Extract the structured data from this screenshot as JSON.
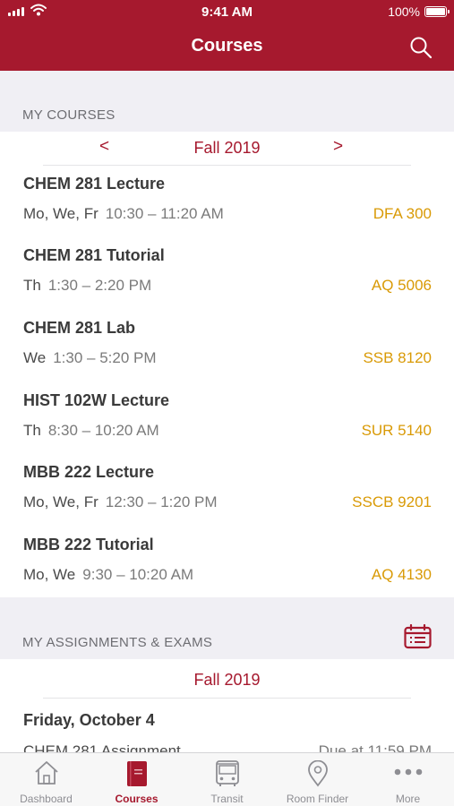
{
  "status_bar": {
    "time": "9:41 AM",
    "battery": "100%"
  },
  "header": {
    "title": "Courses",
    "search_icon": "search-icon"
  },
  "my_courses": {
    "section_label": "MY COURSES",
    "term": "Fall 2019",
    "prev": "<",
    "next": ">",
    "courses": [
      {
        "name": "CHEM 281 Lecture",
        "days": "Mo, We, Fr",
        "time": "10:30 – 11:20 AM",
        "room": "DFA 300"
      },
      {
        "name": "CHEM 281 Tutorial",
        "days": "Th",
        "time": "1:30 – 2:20 PM",
        "room": "AQ 5006"
      },
      {
        "name": "CHEM 281 Lab",
        "days": "We",
        "time": "1:30 – 5:20 PM",
        "room": "SSB 8120"
      },
      {
        "name": "HIST 102W Lecture",
        "days": "Th",
        "time": "8:30 – 10:20 AM",
        "room": "SUR 5140"
      },
      {
        "name": "MBB 222 Lecture",
        "days": "Mo, We, Fr",
        "time": "12:30 – 1:20 PM",
        "room": "SSCB 9201"
      },
      {
        "name": "MBB 222 Tutorial",
        "days": "Mo, We",
        "time": "9:30 – 10:20 AM",
        "room": "AQ 4130"
      }
    ]
  },
  "assignments": {
    "section_label": "MY ASSIGNMENTS & EXAMS",
    "calendar_icon": "calendar-icon",
    "term": "Fall 2019",
    "date": "Friday, October 4",
    "item_name": "CHEM 281 Assignment",
    "item_due": "Due at 11:59 PM"
  },
  "tabbar": {
    "tabs": [
      {
        "label": "Dashboard",
        "icon": "home-icon",
        "active": false
      },
      {
        "label": "Courses",
        "icon": "book-icon",
        "active": true
      },
      {
        "label": "Transit",
        "icon": "bus-icon",
        "active": false
      },
      {
        "label": "Room Finder",
        "icon": "map-pin-icon",
        "active": false
      },
      {
        "label": "More",
        "icon": "more-icon",
        "active": false
      }
    ]
  },
  "colors": {
    "brand": "#a6192e",
    "room_text": "#d99a06",
    "background": "#f0eff4"
  }
}
